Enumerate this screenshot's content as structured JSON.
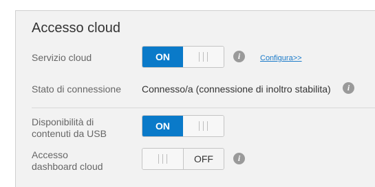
{
  "panel": {
    "title": "Accesso cloud"
  },
  "rows": {
    "cloud_service": {
      "label": "Servizio cloud",
      "toggle_state": "ON",
      "on_label": "ON",
      "link_label": "Configura>>"
    },
    "connection_status": {
      "label": "Stato di connessione",
      "value": "Connesso/a (connessione di inoltro stabilita)"
    },
    "usb_content": {
      "label_line1": "Disponibilità di",
      "label_line2": "contenuti da USB",
      "toggle_state": "ON",
      "on_label": "ON"
    },
    "cloud_dashboard": {
      "label_line1": "Accesso",
      "label_line2": "dashboard cloud",
      "toggle_state": "OFF",
      "off_label": "OFF"
    }
  },
  "icons": {
    "info": "info-icon"
  },
  "colors": {
    "accent": "#0a7ac9",
    "link": "#1a7ac9",
    "panel_bg": "#f2f2f2"
  }
}
